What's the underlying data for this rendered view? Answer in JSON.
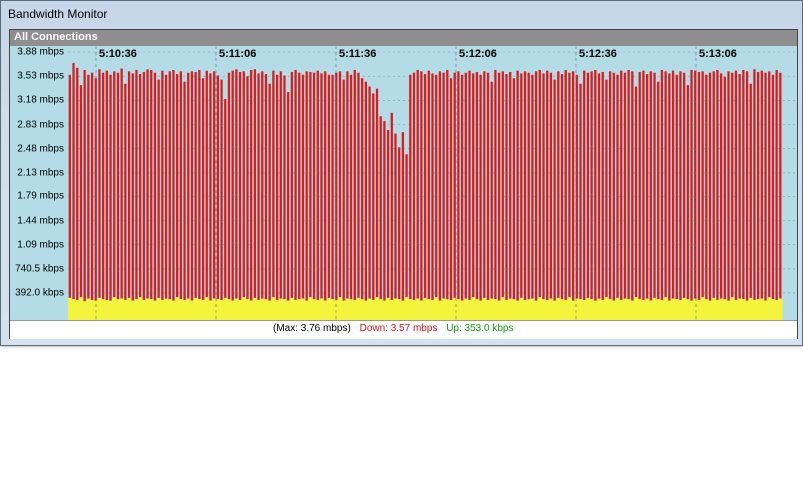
{
  "window": {
    "title": "Bandwidth Monitor"
  },
  "panel": {
    "header": "All Connections"
  },
  "colors": {
    "download": "#dc1c1c",
    "upload": "#f4f43c",
    "plot_background": "#b3dce6",
    "grid": "#5a6a70",
    "down_text": "#e01010",
    "up_text": "#10a010"
  },
  "status": {
    "max": "(Max: 3.76 mbps)",
    "down": "Down: 3.57 mbps",
    "up": "Up: 353.0 kbps"
  },
  "chart_data": {
    "type": "bar",
    "stacked": true,
    "y_tick_labels": [
      "3.88 mbps",
      "3.53 mbps",
      "3.18 mbps",
      "2.83 mbps",
      "2.48 mbps",
      "2.13 mbps",
      "1.79 mbps",
      "1.44 mbps",
      "1.09 mbps",
      "740.5 kbps",
      "392.0 kbps"
    ],
    "y_tick_values_mbps": [
      3.88,
      3.53,
      3.18,
      2.83,
      2.48,
      2.13,
      1.79,
      1.44,
      1.09,
      0.7405,
      0.392
    ],
    "ylim_mbps": [
      0,
      3.88
    ],
    "x_tick_labels": [
      "5:10:36",
      "5:11:06",
      "5:11:36",
      "5:12:06",
      "5:12:36",
      "5:13:06"
    ],
    "series": [
      {
        "name": "Down",
        "values": [
          3.55,
          3.72,
          3.65,
          3.4,
          3.62,
          3.55,
          3.58,
          3.5,
          3.63,
          3.58,
          3.61,
          3.55,
          3.6,
          3.58,
          3.64,
          3.42,
          3.6,
          3.57,
          3.62,
          3.56,
          3.59,
          3.63,
          3.62,
          3.58,
          3.48,
          3.61,
          3.55,
          3.6,
          3.62,
          3.56,
          3.6,
          3.45,
          3.58,
          3.6,
          3.59,
          3.62,
          3.5,
          3.61,
          3.57,
          3.6,
          3.54,
          3.48,
          3.2,
          3.58,
          3.61,
          3.63,
          3.59,
          3.6,
          3.53,
          3.62,
          3.63,
          3.57,
          3.6,
          3.56,
          3.42,
          3.61,
          3.55,
          3.6,
          3.54,
          3.3,
          3.59,
          3.62,
          3.58,
          3.55,
          3.6,
          3.59,
          3.58,
          3.61,
          3.57,
          3.6,
          3.55,
          3.55,
          3.58,
          3.6,
          3.48,
          3.6,
          3.55,
          3.62,
          3.58,
          3.5,
          3.45,
          3.38,
          3.28,
          3.35,
          2.95,
          2.88,
          2.75,
          3.0,
          2.7,
          2.5,
          2.72,
          2.4,
          3.55,
          3.58,
          3.62,
          3.6,
          3.56,
          3.61,
          3.57,
          3.55,
          3.6,
          3.58,
          3.62,
          3.5,
          3.58,
          3.6,
          3.55,
          3.58,
          3.61,
          3.57,
          3.59,
          3.55,
          3.6,
          3.58,
          3.45,
          3.62,
          3.58,
          3.6,
          3.56,
          3.59,
          3.5,
          3.61,
          3.57,
          3.6,
          3.58,
          3.55,
          3.6,
          3.62,
          3.57,
          3.61,
          3.58,
          3.48,
          3.6,
          3.56,
          3.62,
          3.58,
          3.6,
          3.55,
          3.42,
          3.61,
          3.58,
          3.6,
          3.62,
          3.57,
          3.59,
          3.48,
          3.6,
          3.58,
          3.55,
          3.61,
          3.58,
          3.62,
          3.6,
          3.38,
          3.59,
          3.61,
          3.56,
          3.6,
          3.58,
          3.45,
          3.62,
          3.6,
          3.57,
          3.61,
          3.55,
          3.6,
          3.58,
          3.4,
          3.62,
          3.61,
          3.59,
          3.6,
          3.55,
          3.58,
          3.6,
          3.62,
          3.57,
          3.52,
          3.6,
          3.58,
          3.61,
          3.56,
          3.62,
          3.6,
          3.42,
          3.63,
          3.59,
          3.61,
          3.58,
          3.6,
          3.55,
          3.62,
          3.58,
          3.6,
          3.57,
          3.62,
          3.58
        ]
      },
      {
        "name": "Up",
        "values": [
          0.32,
          0.3,
          0.29,
          0.33,
          0.27,
          0.31,
          0.29,
          0.28,
          0.32,
          0.3,
          0.29,
          0.28,
          0.33,
          0.3,
          0.31,
          0.29,
          0.32,
          0.28,
          0.3,
          0.33,
          0.29,
          0.31,
          0.3,
          0.28,
          0.32,
          0.29,
          0.31,
          0.3,
          0.28,
          0.33,
          0.3,
          0.29,
          0.31,
          0.28,
          0.32,
          0.3,
          0.29,
          0.33,
          0.28,
          0.31,
          0.3,
          0.29,
          0.32,
          0.3,
          0.28,
          0.31,
          0.29,
          0.33,
          0.3,
          0.28,
          0.32,
          0.29,
          0.31,
          0.3,
          0.28,
          0.33,
          0.29,
          0.31,
          0.3,
          0.28,
          0.32,
          0.29,
          0.3,
          0.31,
          0.28,
          0.33,
          0.3,
          0.29,
          0.31,
          0.28,
          0.32,
          0.3,
          0.29,
          0.33,
          0.28,
          0.31,
          0.3,
          0.29,
          0.32,
          0.3,
          0.28,
          0.31,
          0.29,
          0.33,
          0.3,
          0.28,
          0.32,
          0.29,
          0.31,
          0.3,
          0.28,
          0.33,
          0.3,
          0.29,
          0.31,
          0.28,
          0.32,
          0.3,
          0.29,
          0.33,
          0.28,
          0.31,
          0.3,
          0.29,
          0.32,
          0.3,
          0.28,
          0.31,
          0.29,
          0.33,
          0.3,
          0.28,
          0.32,
          0.29,
          0.31,
          0.3,
          0.28,
          0.33,
          0.29,
          0.31,
          0.3,
          0.28,
          0.32,
          0.29,
          0.3,
          0.31,
          0.28,
          0.33,
          0.3,
          0.29,
          0.31,
          0.28,
          0.32,
          0.3,
          0.29,
          0.33,
          0.28,
          0.31,
          0.3,
          0.29,
          0.32,
          0.3,
          0.28,
          0.31,
          0.29,
          0.33,
          0.3,
          0.28,
          0.32,
          0.29,
          0.31,
          0.3,
          0.28,
          0.33,
          0.3,
          0.29,
          0.31,
          0.28,
          0.32,
          0.3,
          0.29,
          0.33,
          0.28,
          0.31,
          0.3,
          0.29,
          0.32,
          0.3,
          0.28,
          0.31,
          0.29,
          0.33,
          0.3,
          0.28,
          0.32,
          0.29,
          0.31,
          0.3,
          0.28,
          0.33,
          0.29,
          0.31,
          0.3,
          0.28,
          0.32,
          0.29,
          0.3,
          0.31,
          0.28,
          0.33,
          0.3,
          0.29,
          0.31
        ]
      }
    ]
  }
}
